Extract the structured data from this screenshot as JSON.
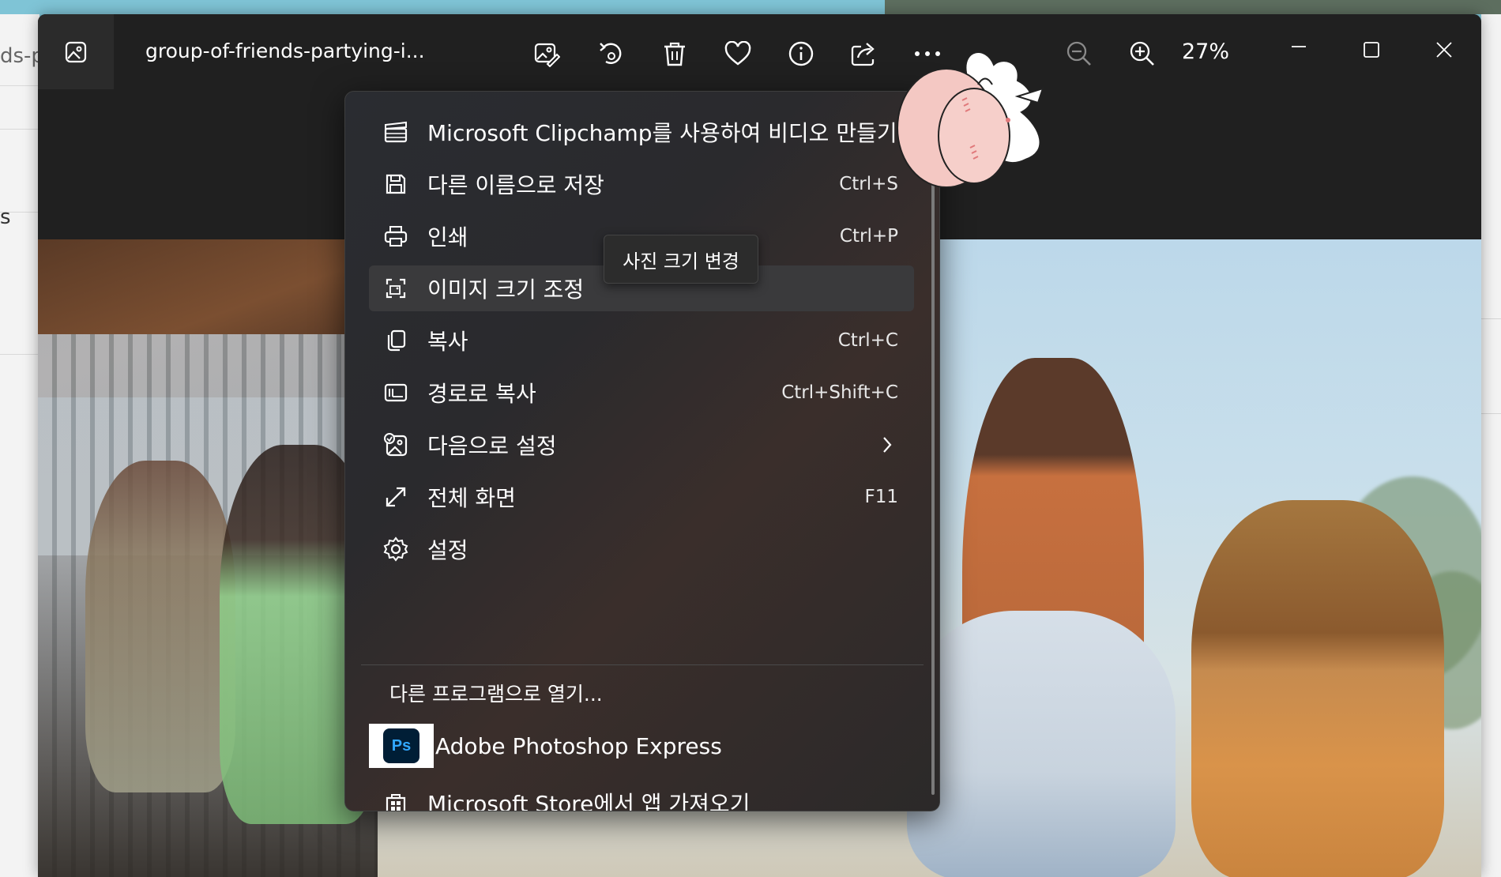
{
  "desktop": {
    "left_fragment": "ds-p",
    "left_letter": "s"
  },
  "window": {
    "file_title": "group-of-friends-partying-i...",
    "zoom_percent": "27%",
    "toolbar_icons": [
      "edit-image-icon",
      "rotate-icon",
      "trash-icon",
      "heart-icon",
      "info-icon",
      "share-icon",
      "more-icon"
    ],
    "zoom_icons": [
      "zoom-out-icon",
      "zoom-in-icon"
    ],
    "window_controls": [
      "minimize-icon",
      "maximize-icon",
      "close-icon"
    ]
  },
  "menu": {
    "items": [
      {
        "label": "Microsoft Clipchamp를 사용하여 비디오 만들기",
        "shortcut": "",
        "icon": "clapperboard-icon"
      },
      {
        "label": "다른 이름으로 저장",
        "shortcut": "Ctrl+S",
        "icon": "save-icon"
      },
      {
        "label": "인쇄",
        "shortcut": "Ctrl+P",
        "icon": "print-icon"
      },
      {
        "label": "이미지 크기 조정",
        "shortcut": "",
        "icon": "resize-image-icon"
      },
      {
        "label": "복사",
        "shortcut": "Ctrl+C",
        "icon": "copy-icon"
      },
      {
        "label": "경로로 복사",
        "shortcut": "Ctrl+Shift+C",
        "icon": "copy-path-icon"
      },
      {
        "label": "다음으로 설정",
        "shortcut": "",
        "icon": "set-as-icon"
      },
      {
        "label": "전체 화면",
        "shortcut": "F11",
        "icon": "fullscreen-icon"
      },
      {
        "label": "설정",
        "shortcut": "",
        "icon": "settings-icon"
      }
    ],
    "open_with": "다른 프로그램으로 열기...",
    "photoshop_label": "Adobe Photoshop Express",
    "photoshop_badge": "Ps",
    "store_label": "Microsoft Store에서 앱 가져오기"
  },
  "tooltip": {
    "text": "사진 크기 변경"
  },
  "colors": {
    "window_bg": "#202020",
    "menu_selected": "#3a3a3c",
    "ps_brand": "#31a8ff"
  }
}
